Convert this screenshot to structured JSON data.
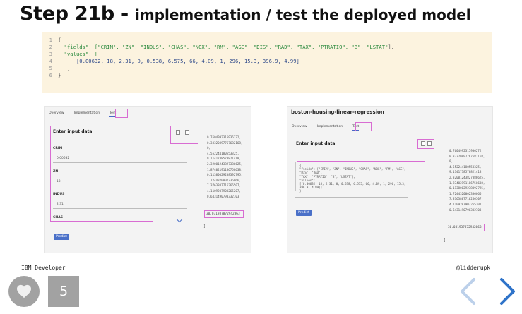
{
  "title": {
    "step": "Step 21b - ",
    "description": "implementation / test the deployed model"
  },
  "code": {
    "line_numbers": [
      "1",
      "2",
      "3",
      "4",
      "5",
      "6"
    ],
    "line1": "{",
    "fields_key": "\"fields\": [",
    "fields_list": "\"CRIM\", \"ZN\", \"INDUS\", \"CHAS\", \"NOX\", \"RM\", \"AGE\", \"DIS\", \"RAD\", \"TAX\", \"PTRATIO\", \"B\", \"LSTAT\"",
    "fields_close": "],",
    "values_key": "\"values\": [",
    "values_list": "[0.00632, 18, 2.31, 0, 0.538, 6.575, 66, 4.09, 1, 296, 15.3, 396.9, 4.99]",
    "line5": "]",
    "line6": "}"
  },
  "left_panel": {
    "tabs": [
      "Overview",
      "Implementation",
      "Test"
    ],
    "form_title": "Enter input data",
    "fields": [
      {
        "label": "CRIM",
        "value": "0.00632"
      },
      {
        "label": "ZN",
        "value": "18"
      },
      {
        "label": "INDUS",
        "value": "2.31"
      },
      {
        "label": "CHAS",
        "value": ""
      }
    ],
    "predict_label": "Predict",
    "coefficients": [
      "0.7604992315936272,",
      "0.33320897767682168,",
      "0,",
      "4.552244180553325,",
      "9.1141738578821418,",
      "2.32001243827386625,",
      "1.87402191186758638,",
      "0.11380029238392795,",
      "1.7244320002336066,",
      "7.3763807716266507,",
      "4.1109207903265207,",
      "0.6431490790332703"
    ],
    "result": "30.031937872942863",
    "brace": "]"
  },
  "right_panel": {
    "title": "boston-housing-linear-regression",
    "tabs": [
      "Overview",
      "Implementation",
      "Test"
    ],
    "form_title": "Enter input data",
    "json_lines": [
      "{",
      "\"fields\": [\"CRIM\", \"ZN\", \"INDUS\", \"CHAS\", \"NOX\", \"RM\", \"AGE\", \"DIS\", \"RAD\",",
      "\"TAX\", \"PTRATIO\", \"B\", \"LSTAT\"],",
      "\"values\":",
      "[[0.00632, 18, 2.31, 0, 0.538, 6.575, 66, 4.09, 1, 296, 15.3, 396.9, 4.99]]",
      "}"
    ],
    "predict_label": "Predict",
    "coefficients": [
      "0.7604992315936272,",
      "0.33320897767682168,",
      "0,",
      "4.552244180553325,",
      "9.1141738578821418,",
      "2.32001243827386625,",
      "1.87402191186758638,",
      "0.11380029238392795,",
      "1.7244320002336066,",
      "7.3763807716266507,",
      "4.1109207903265207,",
      "0.6431490790332703"
    ],
    "result": "30.031937872942863",
    "brace": "]"
  },
  "footer": {
    "left": "IBM Developer",
    "right": "@lidderupk"
  },
  "likes": {
    "count": "5",
    "icon": "heart-icon"
  },
  "colors": {
    "highlight": "#d86cd2",
    "accent": "#4a70c8",
    "code_bg": "#fcf3df",
    "nav_arrow": "#2f73c9"
  }
}
